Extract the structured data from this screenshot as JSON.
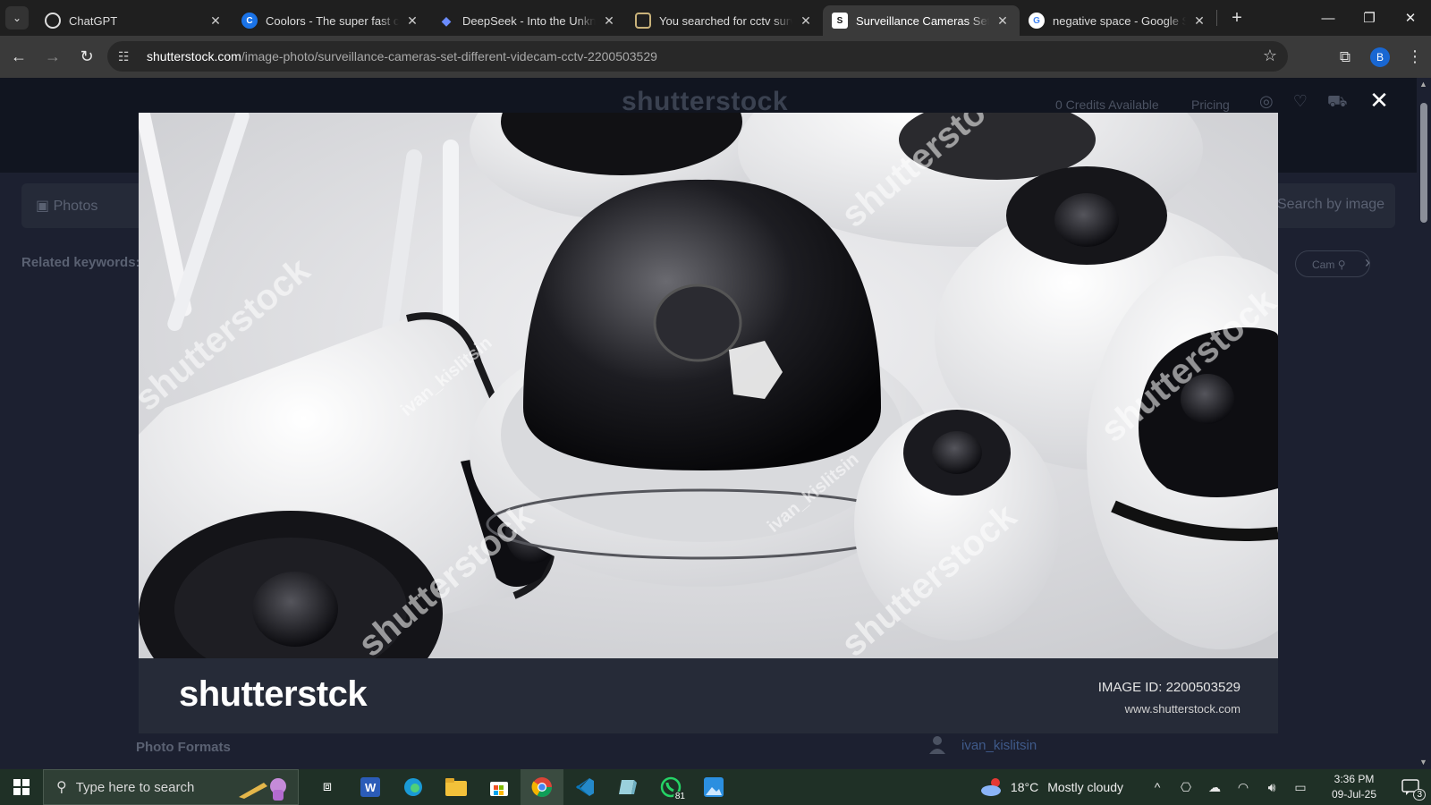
{
  "browser": {
    "tabs": [
      {
        "title": "ChatGPT",
        "icon": "chatgpt-icon",
        "active": false
      },
      {
        "title": "Coolors - The super fast color palettes generator",
        "icon": "coolors-icon",
        "active": false
      },
      {
        "title": "DeepSeek - Into the Unknown",
        "icon": "deepseek-icon",
        "active": false
      },
      {
        "title": "You searched for cctv surveillance",
        "icon": "site-icon",
        "active": false
      },
      {
        "title": "Surveillance Cameras Set Different",
        "icon": "shutterstock-icon",
        "active": true
      },
      {
        "title": "negative space - Google Search",
        "icon": "google-icon",
        "active": false
      }
    ],
    "new_tab": "+",
    "address": {
      "host": "shutterstock.com",
      "path": "/image-photo/surveillance-cameras-set-different-videcam-cctv-2200503529"
    },
    "profile_initial": "B"
  },
  "page_bg": {
    "logo": "shutterstock",
    "credits": "0 Credits Available",
    "pricing": "Pricing",
    "photos_label": "Photos",
    "search_by_image": "Search by image",
    "related_keywords": "Related keywords:",
    "keyword_chip": "Cam",
    "photo_formats": "Photo Formats",
    "author": "ivan_kislitsin"
  },
  "lightbox": {
    "watermark_text": "shutterstock",
    "author_watermark": "ivan_kislitsin",
    "brand": "shutterstck",
    "image_id_label": "IMAGE ID: 2200503529",
    "site": "www.shutterstock.com"
  },
  "taskbar": {
    "search_placeholder": "Type here to search",
    "whatsapp_badge": "81",
    "weather_temp": "18°C",
    "weather_desc": "Mostly cloudy",
    "time": "3:36 PM",
    "date": "09-Jul-25",
    "notification_count": "3"
  }
}
